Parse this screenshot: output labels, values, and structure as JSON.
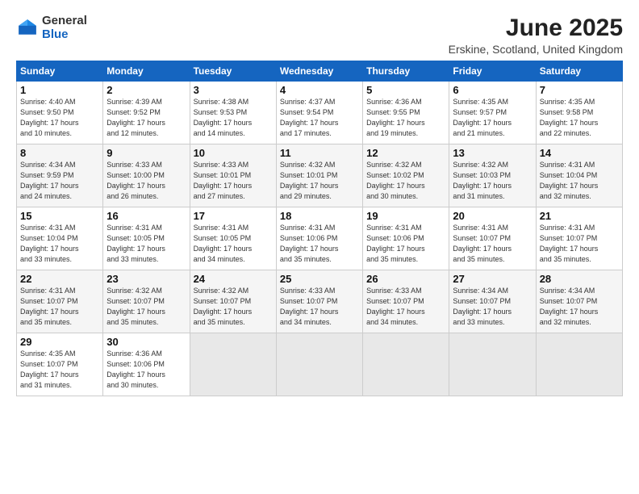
{
  "header": {
    "logo_general": "General",
    "logo_blue": "Blue",
    "title": "June 2025",
    "location": "Erskine, Scotland, United Kingdom"
  },
  "columns": [
    "Sunday",
    "Monday",
    "Tuesday",
    "Wednesday",
    "Thursday",
    "Friday",
    "Saturday"
  ],
  "weeks": [
    [
      {
        "day": "1",
        "info": "Sunrise: 4:40 AM\nSunset: 9:50 PM\nDaylight: 17 hours\nand 10 minutes."
      },
      {
        "day": "2",
        "info": "Sunrise: 4:39 AM\nSunset: 9:52 PM\nDaylight: 17 hours\nand 12 minutes."
      },
      {
        "day": "3",
        "info": "Sunrise: 4:38 AM\nSunset: 9:53 PM\nDaylight: 17 hours\nand 14 minutes."
      },
      {
        "day": "4",
        "info": "Sunrise: 4:37 AM\nSunset: 9:54 PM\nDaylight: 17 hours\nand 17 minutes."
      },
      {
        "day": "5",
        "info": "Sunrise: 4:36 AM\nSunset: 9:55 PM\nDaylight: 17 hours\nand 19 minutes."
      },
      {
        "day": "6",
        "info": "Sunrise: 4:35 AM\nSunset: 9:57 PM\nDaylight: 17 hours\nand 21 minutes."
      },
      {
        "day": "7",
        "info": "Sunrise: 4:35 AM\nSunset: 9:58 PM\nDaylight: 17 hours\nand 22 minutes."
      }
    ],
    [
      {
        "day": "8",
        "info": "Sunrise: 4:34 AM\nSunset: 9:59 PM\nDaylight: 17 hours\nand 24 minutes."
      },
      {
        "day": "9",
        "info": "Sunrise: 4:33 AM\nSunset: 10:00 PM\nDaylight: 17 hours\nand 26 minutes."
      },
      {
        "day": "10",
        "info": "Sunrise: 4:33 AM\nSunset: 10:01 PM\nDaylight: 17 hours\nand 27 minutes."
      },
      {
        "day": "11",
        "info": "Sunrise: 4:32 AM\nSunset: 10:01 PM\nDaylight: 17 hours\nand 29 minutes."
      },
      {
        "day": "12",
        "info": "Sunrise: 4:32 AM\nSunset: 10:02 PM\nDaylight: 17 hours\nand 30 minutes."
      },
      {
        "day": "13",
        "info": "Sunrise: 4:32 AM\nSunset: 10:03 PM\nDaylight: 17 hours\nand 31 minutes."
      },
      {
        "day": "14",
        "info": "Sunrise: 4:31 AM\nSunset: 10:04 PM\nDaylight: 17 hours\nand 32 minutes."
      }
    ],
    [
      {
        "day": "15",
        "info": "Sunrise: 4:31 AM\nSunset: 10:04 PM\nDaylight: 17 hours\nand 33 minutes."
      },
      {
        "day": "16",
        "info": "Sunrise: 4:31 AM\nSunset: 10:05 PM\nDaylight: 17 hours\nand 33 minutes."
      },
      {
        "day": "17",
        "info": "Sunrise: 4:31 AM\nSunset: 10:05 PM\nDaylight: 17 hours\nand 34 minutes."
      },
      {
        "day": "18",
        "info": "Sunrise: 4:31 AM\nSunset: 10:06 PM\nDaylight: 17 hours\nand 35 minutes."
      },
      {
        "day": "19",
        "info": "Sunrise: 4:31 AM\nSunset: 10:06 PM\nDaylight: 17 hours\nand 35 minutes."
      },
      {
        "day": "20",
        "info": "Sunrise: 4:31 AM\nSunset: 10:07 PM\nDaylight: 17 hours\nand 35 minutes."
      },
      {
        "day": "21",
        "info": "Sunrise: 4:31 AM\nSunset: 10:07 PM\nDaylight: 17 hours\nand 35 minutes."
      }
    ],
    [
      {
        "day": "22",
        "info": "Sunrise: 4:31 AM\nSunset: 10:07 PM\nDaylight: 17 hours\nand 35 minutes."
      },
      {
        "day": "23",
        "info": "Sunrise: 4:32 AM\nSunset: 10:07 PM\nDaylight: 17 hours\nand 35 minutes."
      },
      {
        "day": "24",
        "info": "Sunrise: 4:32 AM\nSunset: 10:07 PM\nDaylight: 17 hours\nand 35 minutes."
      },
      {
        "day": "25",
        "info": "Sunrise: 4:33 AM\nSunset: 10:07 PM\nDaylight: 17 hours\nand 34 minutes."
      },
      {
        "day": "26",
        "info": "Sunrise: 4:33 AM\nSunset: 10:07 PM\nDaylight: 17 hours\nand 34 minutes."
      },
      {
        "day": "27",
        "info": "Sunrise: 4:34 AM\nSunset: 10:07 PM\nDaylight: 17 hours\nand 33 minutes."
      },
      {
        "day": "28",
        "info": "Sunrise: 4:34 AM\nSunset: 10:07 PM\nDaylight: 17 hours\nand 32 minutes."
      }
    ],
    [
      {
        "day": "29",
        "info": "Sunrise: 4:35 AM\nSunset: 10:07 PM\nDaylight: 17 hours\nand 31 minutes."
      },
      {
        "day": "30",
        "info": "Sunrise: 4:36 AM\nSunset: 10:06 PM\nDaylight: 17 hours\nand 30 minutes."
      },
      {
        "day": "",
        "info": "",
        "empty": true
      },
      {
        "day": "",
        "info": "",
        "empty": true
      },
      {
        "day": "",
        "info": "",
        "empty": true
      },
      {
        "day": "",
        "info": "",
        "empty": true
      },
      {
        "day": "",
        "info": "",
        "empty": true
      }
    ]
  ]
}
